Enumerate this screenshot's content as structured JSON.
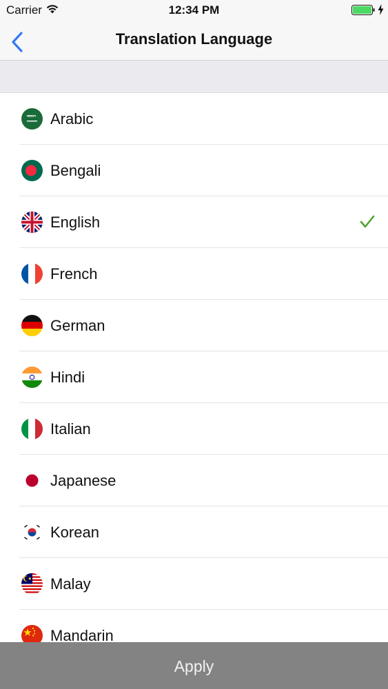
{
  "status_bar": {
    "carrier": "Carrier",
    "time": "12:34 PM",
    "battery_color": "#4cd964"
  },
  "nav": {
    "title": "Translation Language",
    "back_icon": "chevron-left-icon",
    "accent_color": "#3478f6"
  },
  "languages": [
    {
      "label": "Arabic",
      "flag": "saudi-arabia-flag",
      "selected": false
    },
    {
      "label": "Bengali",
      "flag": "bangladesh-flag",
      "selected": false
    },
    {
      "label": "English",
      "flag": "uk-flag",
      "selected": true
    },
    {
      "label": "French",
      "flag": "france-flag",
      "selected": false
    },
    {
      "label": "German",
      "flag": "germany-flag",
      "selected": false
    },
    {
      "label": "Hindi",
      "flag": "india-flag",
      "selected": false
    },
    {
      "label": "Italian",
      "flag": "italy-flag",
      "selected": false
    },
    {
      "label": "Japanese",
      "flag": "japan-flag",
      "selected": false
    },
    {
      "label": "Korean",
      "flag": "south-korea-flag",
      "selected": false
    },
    {
      "label": "Malay",
      "flag": "malaysia-flag",
      "selected": false
    },
    {
      "label": "Mandarin",
      "flag": "china-flag",
      "selected": false
    }
  ],
  "checkmark_color": "#4ca52c",
  "apply": {
    "label": "Apply"
  }
}
